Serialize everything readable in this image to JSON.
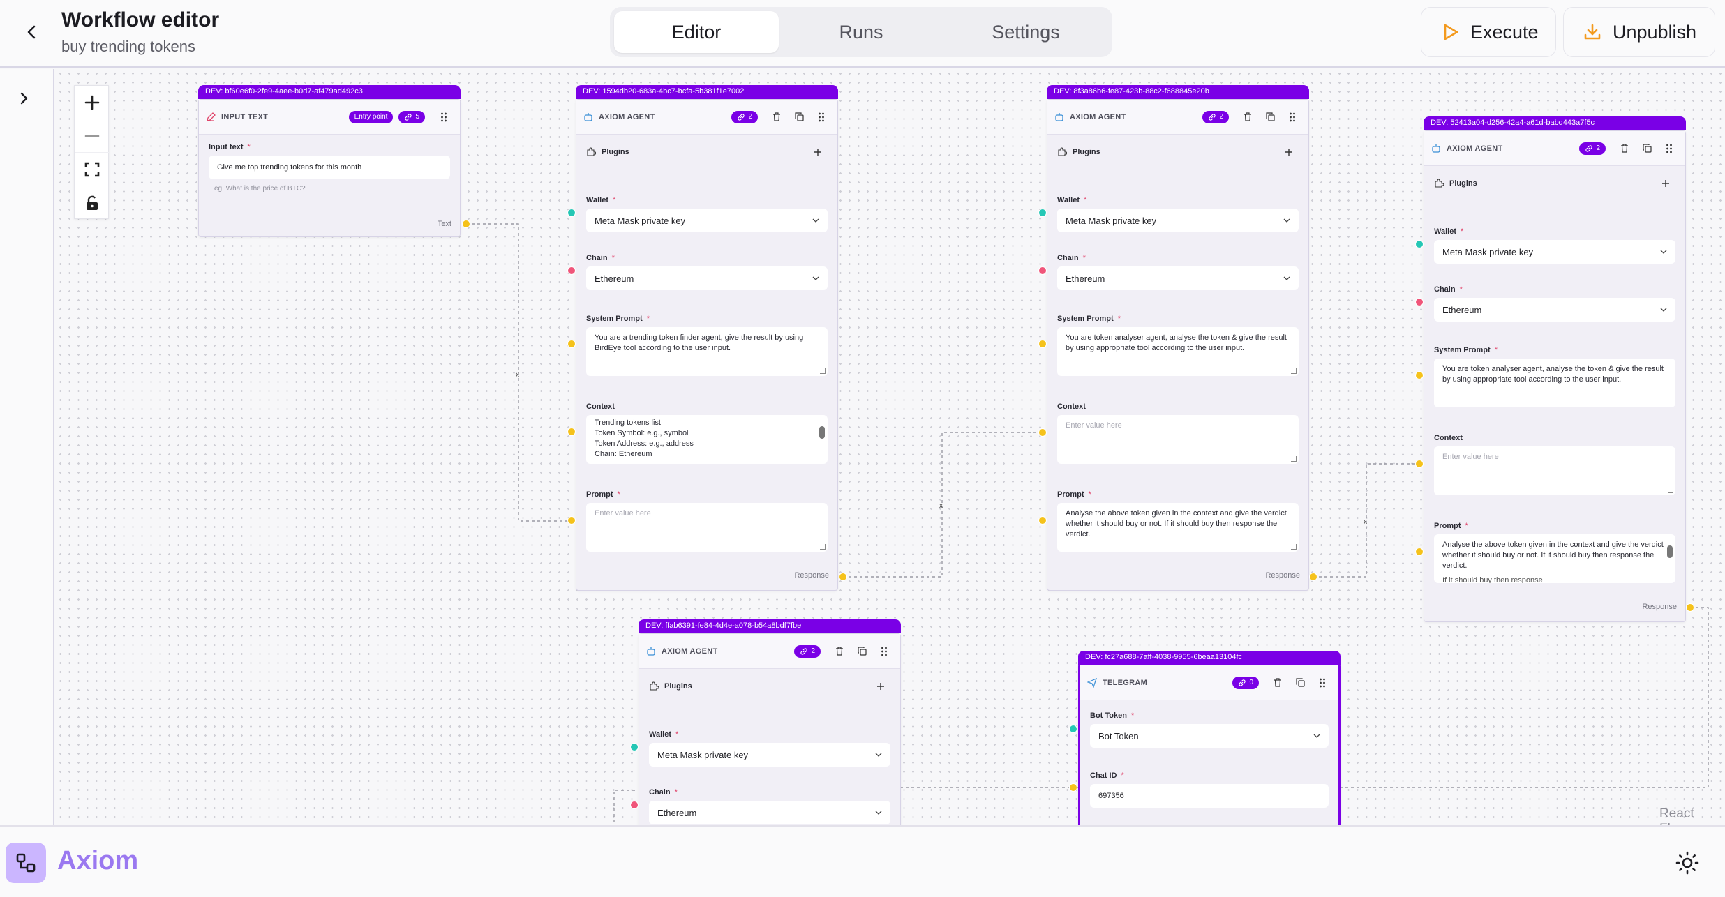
{
  "header": {
    "title": "Workflow editor",
    "subtitle": "buy trending tokens",
    "tabs": [
      {
        "label": "Editor",
        "active": true
      },
      {
        "label": "Runs",
        "active": false
      },
      {
        "label": "Settings",
        "active": false
      }
    ],
    "execute_label": "Execute",
    "unpublish_label": "Unpublish"
  },
  "colors": {
    "accent": "#7a00e6",
    "execute_icon": "#f39a1e",
    "handle_yellow": "#f5c21b",
    "handle_teal": "#25c7b5",
    "handle_red": "#f0557a",
    "brand": "#9a78f0"
  },
  "nodes": {
    "input": {
      "dev": "DEV: bf60e6f0-2fe9-4aee-b0d7-af479ad492c3",
      "type": "INPUT TEXT",
      "badge": "Entry point",
      "count": "5",
      "field_label": "Input text",
      "value": "Give me top trending tokens for this month",
      "hint": "eg: What is the price of BTC?",
      "output_label": "Text"
    },
    "agent1": {
      "dev": "DEV: 1594db20-683a-4bc7-bcfa-5b381f1e7002",
      "type": "AXIOM AGENT",
      "count": "2",
      "plugins": "Plugins",
      "wallet_label": "Wallet",
      "wallet": "Meta Mask private key",
      "chain_label": "Chain",
      "chain": "Ethereum",
      "system_label": "System Prompt",
      "system": "You are a trending token finder agent, give the result by using BirdEye tool according to the user input.",
      "context_label": "Context",
      "context": [
        "Trending tokens list",
        "Token Symbol: e.g., symbol",
        "Token Address: e.g., address",
        "Chain: Ethereum"
      ],
      "prompt_label": "Prompt",
      "prompt_placeholder": "Enter value here",
      "output_label": "Response"
    },
    "agent2": {
      "dev": "DEV: 8f3a86b6-fe87-423b-88c2-f688845e20b",
      "type": "AXIOM AGENT",
      "count": "2",
      "plugins": "Plugins",
      "wallet_label": "Wallet",
      "wallet": "Meta Mask private key",
      "chain_label": "Chain",
      "chain": "Ethereum",
      "system_label": "System Prompt",
      "system": "You are token analyser agent, analyse the token & give the result by using appropriate tool according to the user input.",
      "context_label": "Context",
      "context_placeholder": "Enter value here",
      "prompt_label": "Prompt",
      "prompt": "Analyse the above token given in the context and give the verdict whether it should buy or not. If it should buy then response the verdict.",
      "output_label": "Response"
    },
    "agent3": {
      "dev": "DEV: 52413a04-d256-42a4-a61d-babd443a7f5c",
      "type": "AXIOM AGENT",
      "count": "2",
      "plugins": "Plugins",
      "wallet_label": "Wallet",
      "wallet": "Meta Mask private key",
      "chain_label": "Chain",
      "chain": "Ethereum",
      "system_label": "System Prompt",
      "system": "You are token analyser agent, analyse the token & give the result by using appropriate tool according to the user input.",
      "context_label": "Context",
      "context_placeholder": "Enter value here",
      "prompt_label": "Prompt",
      "prompt": "Analyse the above token given in the context and give the verdict whether it should buy or not. If it should buy then response the verdict.",
      "prompt_overflow": "If it should buy then response",
      "output_label": "Response"
    },
    "agent4": {
      "dev": "DEV: ffab6391-fe84-4d4e-a078-b54a8bdf7fbe",
      "type": "AXIOM AGENT",
      "count": "2",
      "plugins": "Plugins",
      "wallet_label": "Wallet",
      "wallet": "Meta Mask private key",
      "chain_label": "Chain",
      "chain": "Ethereum"
    },
    "telegram": {
      "dev": "DEV: fc27a688-7aff-4038-9955-6beaa13104fc",
      "type": "TELEGRAM",
      "count": "0",
      "bot_label": "Bot Token",
      "bot": "Bot Token",
      "chat_label": "Chat ID",
      "chat": "697356"
    }
  },
  "edge_marker": "x",
  "attribution": "React Flow",
  "footer": {
    "brand": "Axiom"
  }
}
